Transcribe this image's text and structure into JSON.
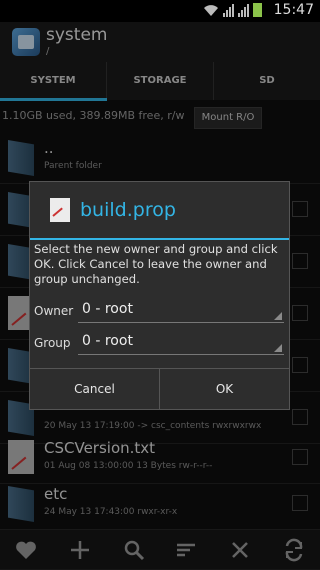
{
  "status": {
    "time": "15:47"
  },
  "app": {
    "title": "system",
    "path": "/"
  },
  "tabs": [
    "SYSTEM",
    "STORAGE",
    "SD"
  ],
  "info": {
    "usage": "1.10GB used, 389.89MB free, r/w",
    "mount_label": "Mount R/O"
  },
  "list": {
    "parent": {
      "name": "..",
      "sub": "Parent folder"
    },
    "rows": [
      {
        "name": "",
        "sub": "20 May 13 17:19:00  -> csc_contents  rwxrwxrwx"
      },
      {
        "name": "CSCVersion.txt",
        "sub": "01 Aug 08 13:00:00  13 Bytes  rw-r--r--"
      },
      {
        "name": "etc",
        "sub": "24 May 13 17:43:00  rwxr-xr-x"
      }
    ]
  },
  "dialog": {
    "title": "build.prop",
    "message": "Select the new owner and group and click OK. Click Cancel to leave the owner and group unchanged.",
    "owner_label": "Owner",
    "owner_value": "0 - root",
    "group_label": "Group",
    "group_value": "0 - root",
    "cancel_label": "Cancel",
    "ok_label": "OK"
  },
  "bottom_icons": [
    "heart-icon",
    "plus-icon",
    "search-icon",
    "filter-icon",
    "close-icon",
    "refresh-icon"
  ],
  "colors": {
    "accent": "#33b5e5",
    "battery": "#8bc34a"
  }
}
